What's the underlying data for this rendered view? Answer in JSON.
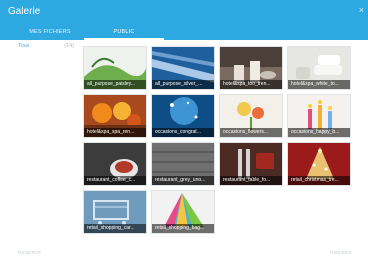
{
  "window": {
    "title": "Galerie",
    "close_glyph": "×"
  },
  "tabs": [
    {
      "label": "MES FICHIERS",
      "active": false
    },
    {
      "label": "PUBLIC",
      "active": true
    }
  ],
  "sidebar": {
    "items": [
      {
        "label": "Tous",
        "count": "(14)"
      }
    ]
  },
  "gallery": {
    "items": [
      {
        "caption": "all_purpose_paisley...",
        "icon": "paisley-image"
      },
      {
        "caption": "all_purpose_silver_...",
        "icon": "silver-blue-image"
      },
      {
        "caption": "hotel&spa_too_tren...",
        "icon": "spa-candles-image"
      },
      {
        "caption": "hotel&spa_white_to...",
        "icon": "white-towels-image"
      },
      {
        "caption": "hotel&spa_spa_ren...",
        "icon": "spa-fruit-image"
      },
      {
        "caption": "occasions_congrat...",
        "icon": "blue-sparkle-image"
      },
      {
        "caption": "occasions_flowers...",
        "icon": "flowers-image"
      },
      {
        "caption": "occasions_happy_b...",
        "icon": "birthday-candles-image"
      },
      {
        "caption": "restaurant_coffee_c...",
        "icon": "coffee-cup-image"
      },
      {
        "caption": "restaurant_grey_uno...",
        "icon": "grey-wood-image"
      },
      {
        "caption": "restaurant_table_fo...",
        "icon": "table-fork-image"
      },
      {
        "caption": "retail_christmas_tre...",
        "icon": "christmas-tree-image"
      },
      {
        "caption": "retail_shopping_car...",
        "icon": "shopping-cart-image"
      },
      {
        "caption": "retail_shopping_bag...",
        "icon": "shopping-bags-image"
      }
    ]
  },
  "footer": {
    "left": "RESERVE",
    "right": "INSERER"
  },
  "colors": {
    "accent": "#2da8e1",
    "link": "#5aa7d6"
  }
}
